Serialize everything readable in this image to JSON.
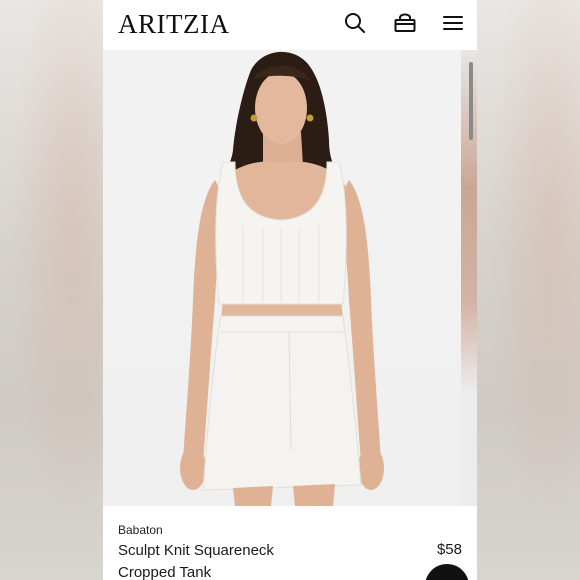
{
  "header": {
    "logo": "ARITZIA",
    "search_icon": "search-icon",
    "bag_icon": "shopping-bag-icon",
    "menu_icon": "hamburger-menu-icon"
  },
  "product": {
    "brand": "Babaton",
    "name_line1": "Sculpt Knit Squareneck",
    "name_line2": "Cropped Tank",
    "price": "$58"
  },
  "colors": {
    "text": "#111111",
    "top_and_skirt": "#f4f2ee",
    "skin": "#e2b69a",
    "hair": "#2b1c14"
  }
}
